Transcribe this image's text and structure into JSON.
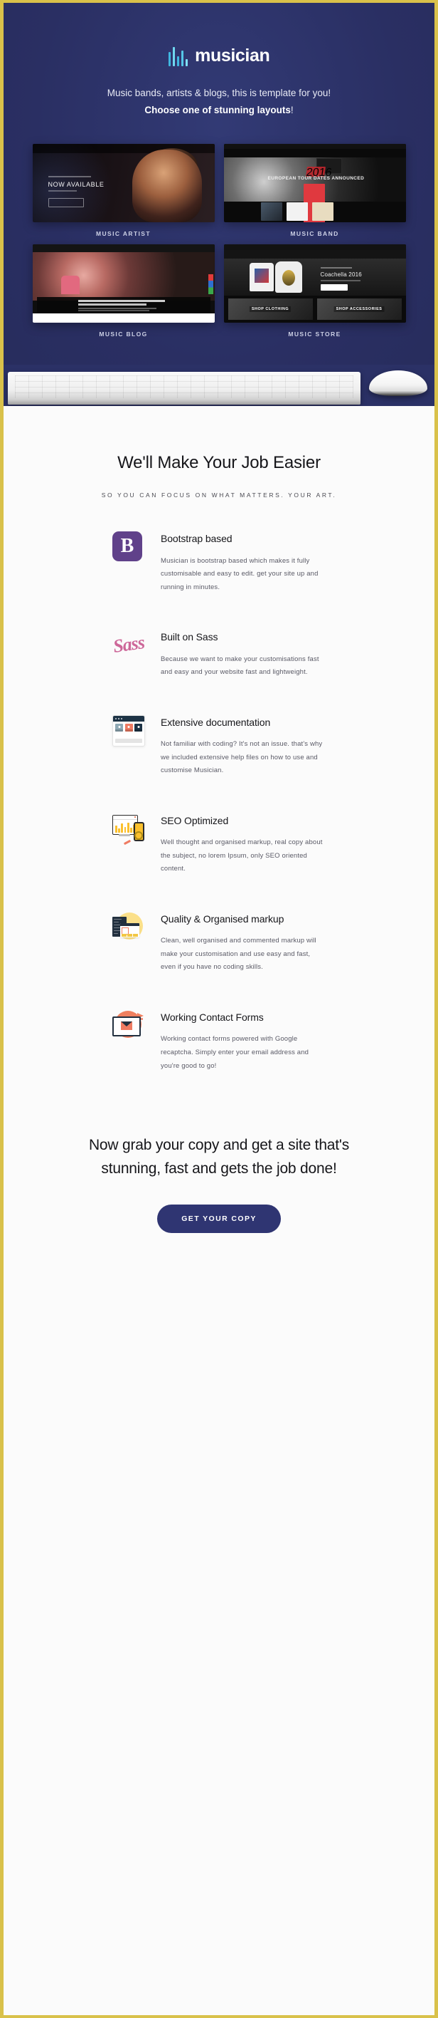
{
  "brand": {
    "name": "musician",
    "logo_icon": "sound-bars-icon",
    "accent_cyan": "#6fd8f0",
    "hero_bg": "#2b3166",
    "page_border": "#d9c14a"
  },
  "hero": {
    "tagline_part1": "Music bands, artists & blogs, this is template for you! ",
    "tagline_bold": "Choose one of stunning layouts",
    "tagline_part2": "!",
    "thumbs": [
      {
        "label": "MUSIC ARTIST",
        "headline": "NOW AVAILABLE"
      },
      {
        "label": "MUSIC BAND",
        "headline": "EUROPEAN TOUR DATES ANNOUNCED",
        "badge": "2016"
      },
      {
        "label": "MUSIC BLOG",
        "headline": "London Music Fest 2016 Announced | AC/DC, Arctic Monkeys, Rammstein and more"
      },
      {
        "label": "MUSIC STORE",
        "headline": "Coachella 2016",
        "tile_left": "SHOP CLOTHING",
        "tile_right": "SHOP ACCESSORIES"
      }
    ],
    "desk_items": [
      "keyboard",
      "mouse"
    ]
  },
  "features_section": {
    "title": "We'll Make Your Job Easier",
    "subtitle": "SO YOU CAN FOCUS ON WHAT MATTERS. YOUR ART.",
    "items": [
      {
        "icon": "bootstrap-icon",
        "icon_glyph": "B",
        "title": "Bootstrap based",
        "desc": "Musician is bootstrap based which makes it fully customisable and easy to edit. get your site up and running in minutes."
      },
      {
        "icon": "sass-icon",
        "icon_glyph": "Sass",
        "title": "Built on Sass",
        "desc": "Because we want to make your customisations fast and easy and your website fast and lightweight."
      },
      {
        "icon": "documentation-icon",
        "title": "Extensive documentation",
        "desc": "Not familiar with coding? It's not an issue. that's why we included extensive help files on how to use and customise Musician."
      },
      {
        "icon": "seo-chart-icon",
        "title": "SEO Optimized",
        "desc": "Well thought and organised markup, real copy about the subject, no lorem Ipsum, only SEO oriented content."
      },
      {
        "icon": "code-window-icon",
        "title": "Quality & Organised markup",
        "desc": "Clean, well organised and commented markup will make your customisation and use easy and fast, even if you have no coding skills."
      },
      {
        "icon": "envelope-icon",
        "title": "Working Contact Forms",
        "desc": "Working contact  forms powered with Google recaptcha. Simply enter your email address and you're good to go!"
      }
    ]
  },
  "cta": {
    "headline": "Now grab your copy and get a site that's stunning, fast and gets the job done!",
    "button_label": "GET YOUR COPY",
    "button_color": "#2f3572"
  }
}
